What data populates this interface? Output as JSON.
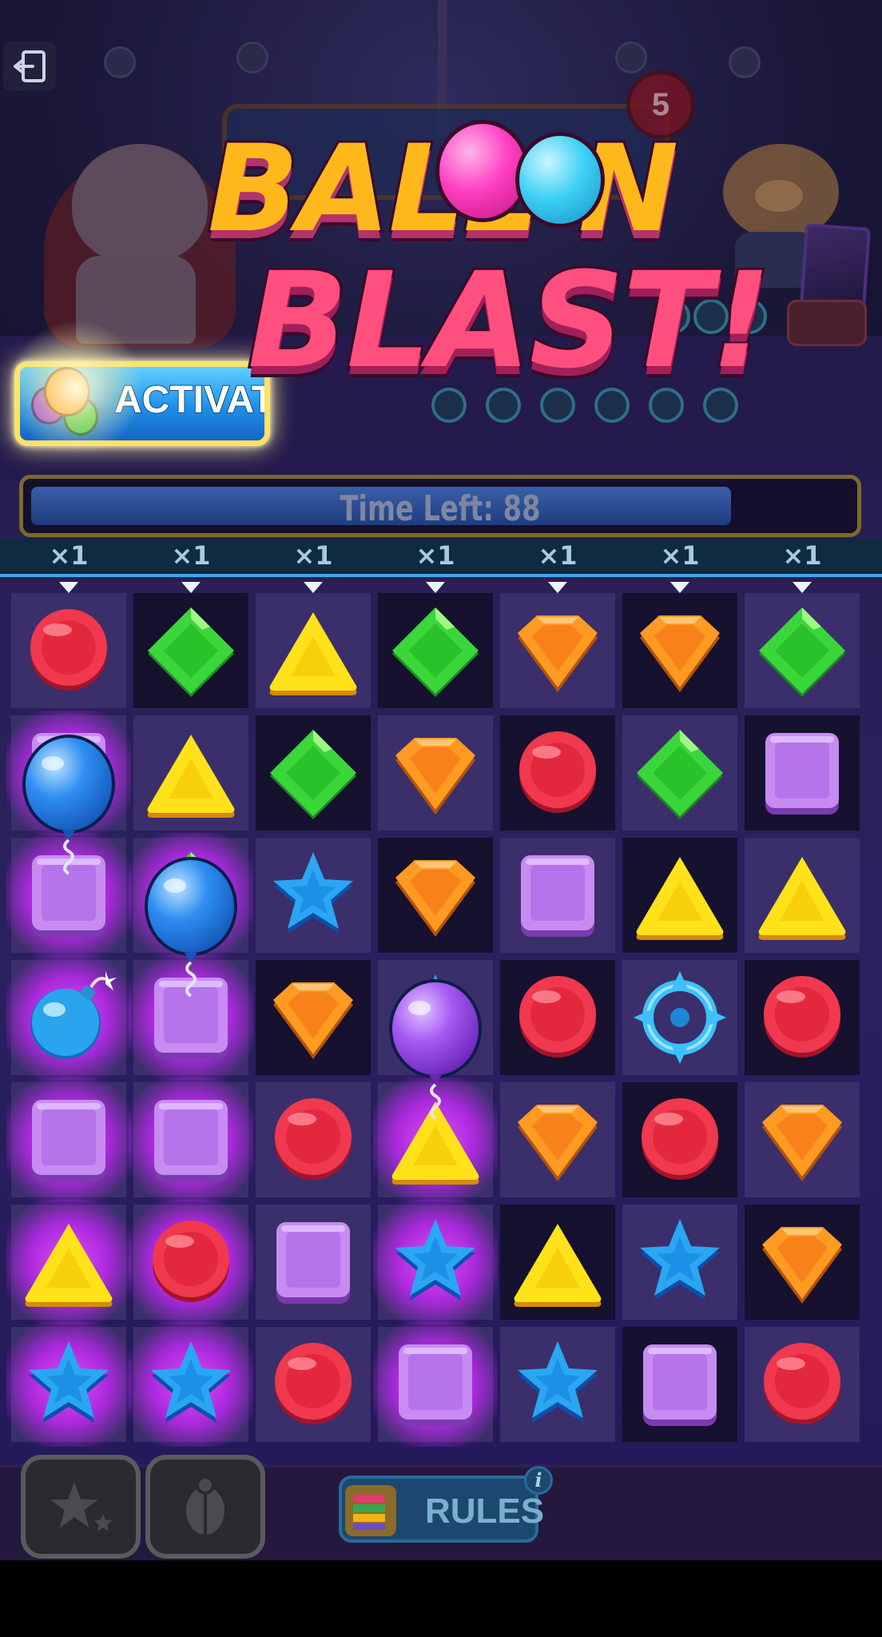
{
  "game": {
    "title_line1": "BALL  N",
    "title_line2": "BLAST!",
    "counter_value": "5",
    "activate_label": "ACTIVAT",
    "timer_text": "Time Left: 88",
    "timer_fraction": 0.855,
    "rules_label": "RULES",
    "info_label": "i"
  },
  "multipliers": [
    "×1",
    "×1",
    "×1",
    "×1",
    "×1",
    "×1",
    "×1"
  ],
  "board": {
    "rows": 7,
    "cols": 7,
    "tiles": [
      [
        "red-circle",
        "green-diamond",
        "yellow-triangle",
        "green-diamond",
        "orange-gem",
        "orange-gem",
        "green-diamond"
      ],
      [
        "purple-square",
        "yellow-triangle",
        "green-diamond",
        "orange-gem",
        "red-circle",
        "green-diamond",
        "purple-square"
      ],
      [
        "purple-square",
        "green-diamond",
        "blue-star",
        "orange-gem",
        "purple-square",
        "yellow-triangle",
        "yellow-triangle"
      ],
      [
        "bomb",
        "purple-square",
        "orange-gem",
        "blue-star",
        "red-circle",
        "target",
        "red-circle"
      ],
      [
        "purple-square",
        "purple-square",
        "red-circle",
        "yellow-triangle",
        "orange-gem",
        "red-circle",
        "orange-gem"
      ],
      [
        "yellow-triangle",
        "red-circle",
        "purple-square",
        "blue-star",
        "yellow-triangle",
        "blue-star",
        "orange-gem"
      ],
      [
        "blue-star",
        "blue-star",
        "red-circle",
        "purple-square",
        "blue-star",
        "purple-square",
        "red-circle"
      ]
    ],
    "shade": [
      [
        "light",
        "dark",
        "light",
        "dark",
        "light",
        "dark",
        "light"
      ],
      [
        "light",
        "light",
        "dark",
        "light",
        "dark",
        "light",
        "dark"
      ],
      [
        "light",
        "light",
        "light",
        "dark",
        "light",
        "dark",
        "light"
      ],
      [
        "light",
        "light",
        "dark",
        "light",
        "dark",
        "light",
        "dark"
      ],
      [
        "light",
        "light",
        "light",
        "light",
        "light",
        "dark",
        "light"
      ],
      [
        "light",
        "light",
        "light",
        "light",
        "dark",
        "light",
        "dark"
      ],
      [
        "light",
        "light",
        "light",
        "light",
        "light",
        "dark",
        "light"
      ]
    ],
    "highlighted": [
      [
        false,
        false,
        false,
        false,
        false,
        false,
        false
      ],
      [
        true,
        false,
        false,
        false,
        false,
        false,
        false
      ],
      [
        true,
        true,
        false,
        false,
        false,
        false,
        false
      ],
      [
        true,
        true,
        false,
        false,
        false,
        false,
        false
      ],
      [
        true,
        true,
        false,
        true,
        false,
        false,
        false
      ],
      [
        true,
        true,
        false,
        true,
        false,
        false,
        false
      ],
      [
        true,
        true,
        false,
        true,
        false,
        false,
        false
      ]
    ],
    "balloons": [
      {
        "color": "blue",
        "row": 1,
        "col": 0
      },
      {
        "color": "blue",
        "row": 2,
        "col": 1
      },
      {
        "color": "purple",
        "row": 3,
        "col": 3
      }
    ]
  },
  "colors": {
    "glow": "#e050ff",
    "activate_border": "#ffe266",
    "timer_border": "#7d6a2a",
    "multiplier_line": "#3fa7e8"
  },
  "icons": {
    "exit": "exit-icon",
    "booster_left": "stars-icon",
    "booster_right": "scarab-icon",
    "rules": "rules-book-icon"
  }
}
